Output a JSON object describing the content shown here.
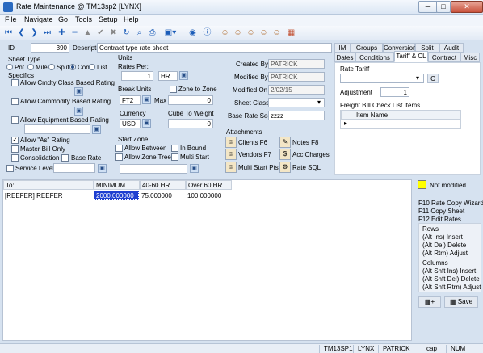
{
  "window": {
    "title": "Rate Maintenance @ TM13sp2 [LYNX]",
    "minimize": "─",
    "maximize": "□",
    "close": "✕"
  },
  "menu": [
    "File",
    "Navigate",
    "Go",
    "Tools",
    "Setup",
    "Help"
  ],
  "form": {
    "id_label": "ID",
    "id_value": "390",
    "desc_label": "Description",
    "desc_value": "Contract type rate sheet",
    "sheet_type": {
      "label": "Sheet Type",
      "options": [
        "Pnt",
        "Mile",
        "Split",
        "Con",
        "List"
      ],
      "selected": "Con"
    },
    "specifics": {
      "label": "Specifics",
      "items": [
        {
          "label": "Allow Cmdty Class Based Rating",
          "checked": false
        },
        {
          "label": "Allow Commodity Based Rating",
          "checked": false
        },
        {
          "label": "Allow Equipment Based Rating",
          "checked": false
        },
        {
          "label": "Allow \"As\" Rating",
          "checked": true
        },
        {
          "label": "Master Bill Only",
          "checked": false
        },
        {
          "label": "Consolidation",
          "checked": false
        },
        {
          "label": "Base Rate",
          "checked": false
        },
        {
          "label": "Service Level",
          "checked": false
        }
      ]
    },
    "units": {
      "label": "Units",
      "rates_per_label": "Rates Per:",
      "rates_per_value": "1",
      "rates_per_unit": "HR",
      "break_units_label": "Break Units",
      "break_units_value": "FT2",
      "max_label": "Max",
      "max_value": "0",
      "zone_to_zone_label": "Zone to Zone",
      "currency_label": "Currency",
      "currency_value": "USD",
      "cube_label": "Cube To Weight",
      "cube_value": "0"
    },
    "start_zone": {
      "label": "Start Zone",
      "items": [
        "Allow Between",
        "In Bound",
        "Allow Zone Tree",
        "Multi Start"
      ]
    },
    "audit": {
      "created_by_label": "Created By",
      "created_by": "PATRICK",
      "modified_by_label": "Modified By",
      "modified_by": "PATRICK",
      "modified_on_label": "Modified On",
      "modified_on": "2/02/15",
      "sheet_class_label": "Sheet Class",
      "sheet_class": "",
      "base_rate_seq_label": "Base Rate Seq",
      "base_rate_seq": "zzzz"
    },
    "attachments": {
      "label": "Attachments",
      "items": [
        "Clients F6",
        "Notes F8",
        "Vendors F7",
        "Acc Charges",
        "Multi Start Pts",
        "Rate SQL"
      ]
    }
  },
  "tabs_row1": [
    "IM",
    "Groups",
    "Conversion",
    "Split",
    "Audit"
  ],
  "tabs_row2": [
    "Dates",
    "Conditions",
    "Tariff & CL",
    "Contract",
    "Misc"
  ],
  "tariff": {
    "rate_tariff_label": "Rate Tariff",
    "c_button": "C",
    "adjustment_label": "Adjustment",
    "adjustment_value": "1",
    "freight_label": "Freight Bill Check List Items",
    "item_name_header": "Item Name"
  },
  "grid": {
    "headers": [
      "To:",
      "MINIMUM",
      "40-60 HR",
      "Over 60 HR"
    ],
    "rows": [
      [
        "[REEFER] REEFER",
        "2000.000000",
        "75.000000",
        "100.000000"
      ]
    ]
  },
  "side": {
    "status": "Not modified",
    "shortcuts": [
      "F10 Rate Copy Wizard",
      "F11 Copy Sheet",
      "F12 Edit Rates"
    ],
    "rows_label": "Rows",
    "row_items": [
      "(Alt Ins) Insert",
      "(Alt Del) Delete",
      "(Alt Rtrn) Adjust"
    ],
    "cols_label": "Columns",
    "col_items": [
      "(Alt Shft Ins) Insert",
      "(Alt Shft Del) Delete",
      "(Alt Shft Rtrn) Adjust"
    ],
    "save_label": "Save",
    "plus_label": "+"
  },
  "status": [
    "TM13SP1",
    "LYNX",
    "PATRICK",
    "cap",
    "NUM"
  ]
}
